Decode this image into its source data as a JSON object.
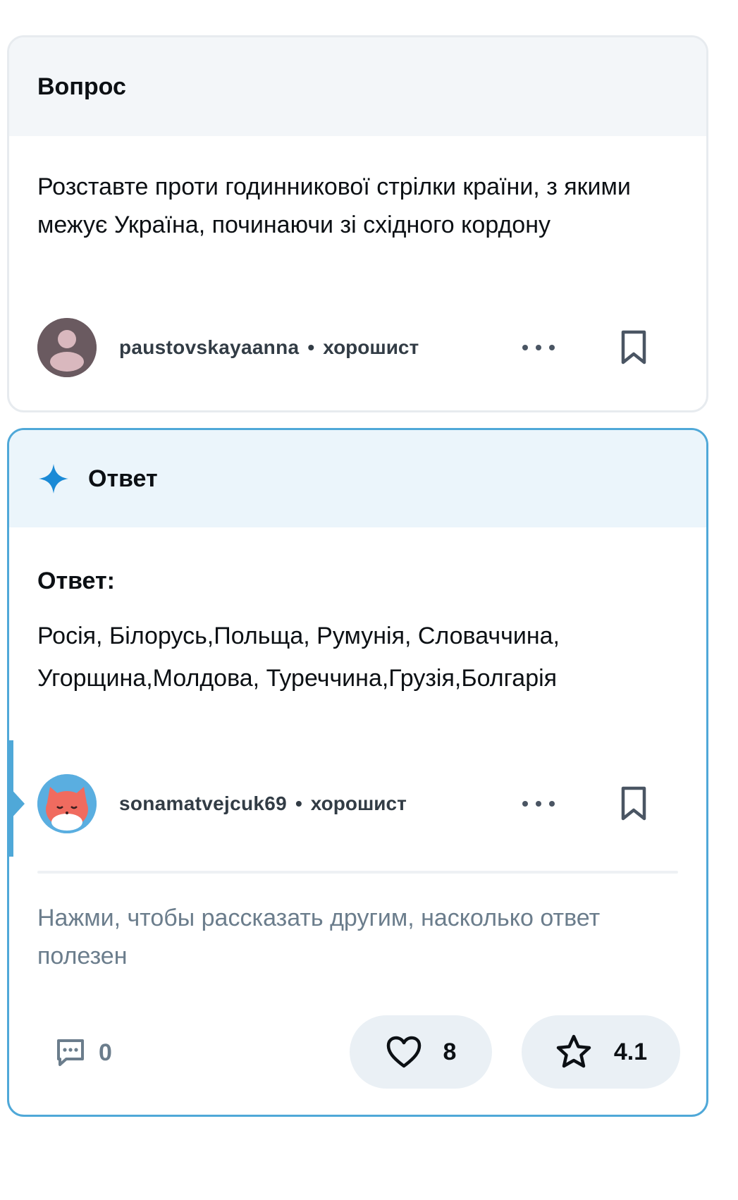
{
  "question": {
    "header_title": "Вопрос",
    "text": "Розставте проти годинникової стрілки країни, з якими межує Україна, починаючи зі східного кордону",
    "author": {
      "username": "paustovskayaanna",
      "separator": "•",
      "rank": "хорошист"
    }
  },
  "answer": {
    "header_title": "Ответ",
    "label": "Ответ:",
    "text": "Росія, Білорусь,Польща, Румунія, Словаччина, Угорщина,Молдова, Туреччина,Грузія,Болгарія",
    "author": {
      "username": "sonamatvejcuk69",
      "separator": "•",
      "rank": "хорошист"
    },
    "rate_prompt": "Нажми, чтобы рассказать другим, насколько ответ полезен",
    "comments_count": "0",
    "likes_count": "8",
    "rating": "4.1"
  },
  "colors": {
    "accent_blue": "#4fa8d8",
    "sparkle_blue": "#1a8ad6",
    "header_bg": "#f3f6f9",
    "answer_header_bg": "#ebf5fb",
    "muted_text": "#6b7d8c"
  },
  "icons": {
    "sparkle": "sparkle-icon",
    "options": "more-options-icon",
    "bookmark": "bookmark-icon",
    "comment": "comment-icon",
    "like": "heart-icon",
    "rating": "star-icon"
  }
}
